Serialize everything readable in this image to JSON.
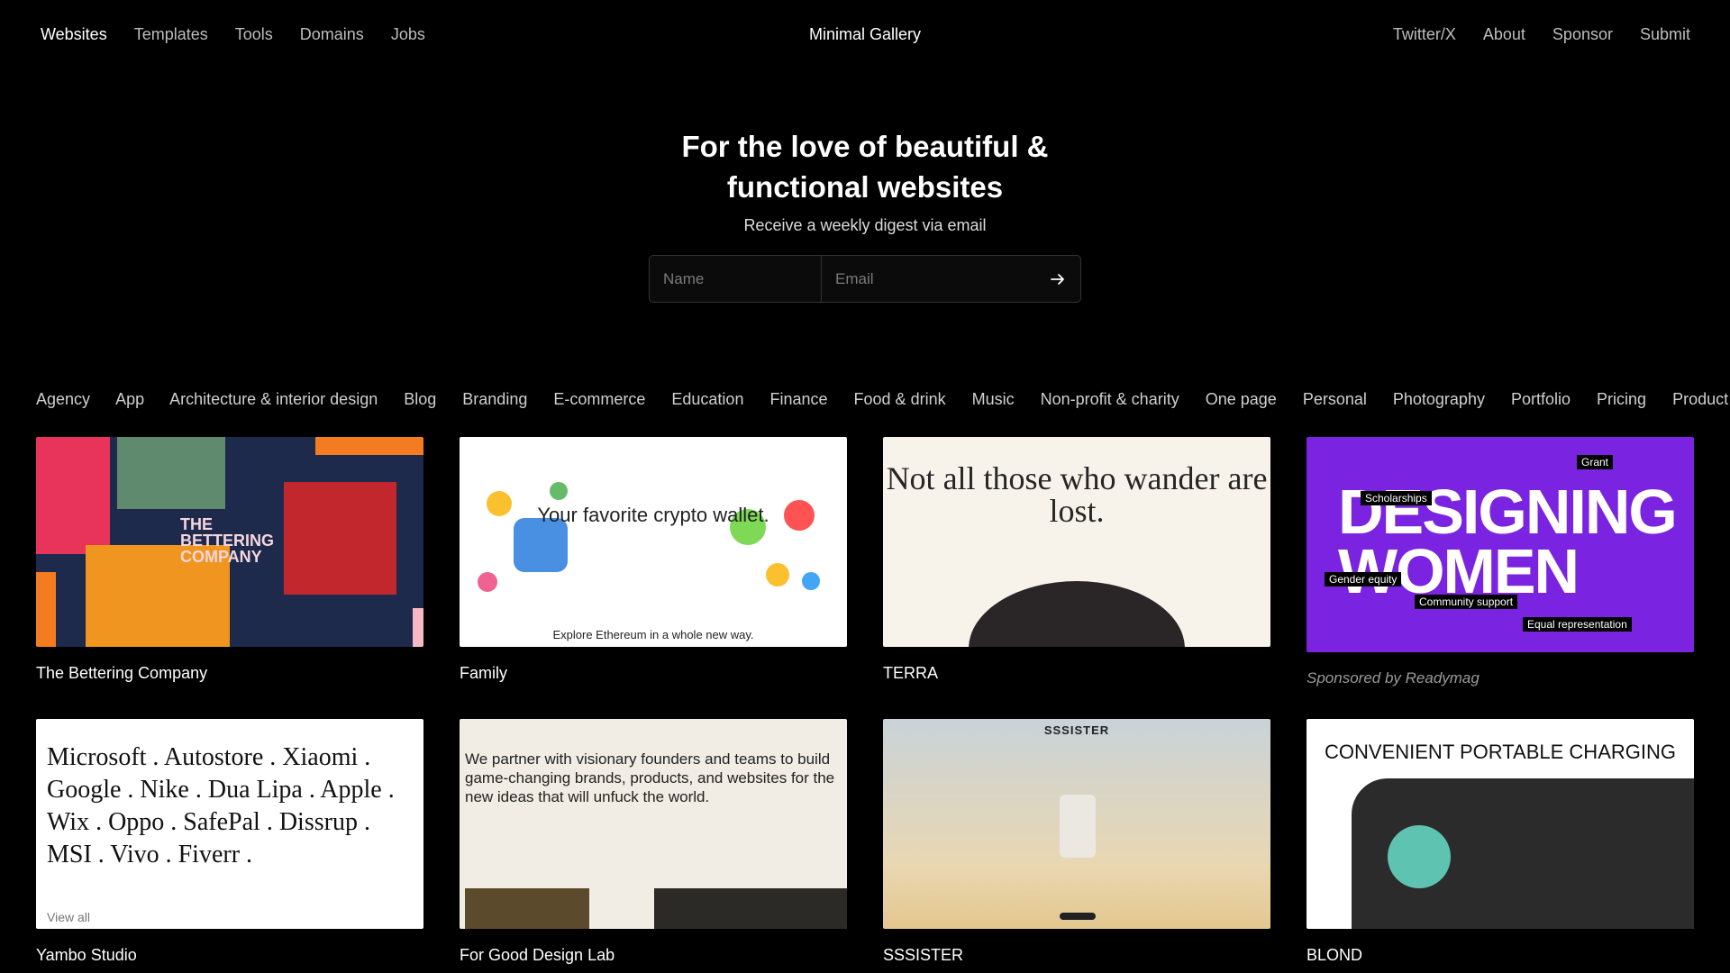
{
  "nav": {
    "left": [
      "Websites",
      "Templates",
      "Tools",
      "Domains",
      "Jobs"
    ],
    "brand": "Minimal Gallery",
    "right": [
      "Twitter/X",
      "About",
      "Sponsor",
      "Submit"
    ]
  },
  "hero": {
    "title_line1": "For the love of beautiful &",
    "title_line2": "functional websites",
    "subtitle": "Receive a weekly digest via email",
    "name_placeholder": "Name",
    "email_placeholder": "Email",
    "submit_icon": "arrow-right-icon"
  },
  "categories": [
    "Agency",
    "App",
    "Architecture & interior design",
    "Blog",
    "Branding",
    "E-commerce",
    "Education",
    "Finance",
    "Food & drink",
    "Music",
    "Non-profit & charity",
    "One page",
    "Personal",
    "Photography",
    "Portfolio",
    "Pricing",
    "Product"
  ],
  "cards": [
    {
      "title": "The Bettering Company",
      "thumb": {
        "text": "THE\nBETTERING\nCOMPANY"
      }
    },
    {
      "title": "Family",
      "thumb": {
        "heading": "Your favorite crypto wallet.",
        "footer": "Explore Ethereum in a whole new way."
      }
    },
    {
      "title": "TERRA",
      "thumb": {
        "heading": "Not all those who wander are lost."
      }
    },
    {
      "title": "",
      "sponsor": "Sponsored by Readymag",
      "thumb": {
        "big": "DESIGNING WOMEN",
        "tags": [
          "Grant",
          "Scholarships",
          "Gender equity",
          "Community support",
          "Equal representation"
        ]
      }
    },
    {
      "title": "Yambo Studio",
      "thumb": {
        "text": "Microsoft . Autostore . Xiaomi . Google . Nike . Dua Lipa . Apple . Wix . Oppo . SafePal . Dissrup . MSI . Vivo . Fiverr .",
        "view_all": "View all"
      }
    },
    {
      "title": "For Good Design Lab",
      "thumb": {
        "text": "We partner with visionary founders and teams to build game-changing brands, products, and websites for the new ideas that will unfuck the world."
      }
    },
    {
      "title": "SSSISTER",
      "thumb": {
        "logo": "SSSISTER"
      }
    },
    {
      "title": "BLOND",
      "thumb": {
        "heading": "CONVENIENT PORTABLE CHARGING"
      }
    }
  ],
  "colors": {
    "background": "#000000",
    "text": "#ffffff",
    "muted": "#bdbdbd",
    "purple": "#7a23e0"
  }
}
